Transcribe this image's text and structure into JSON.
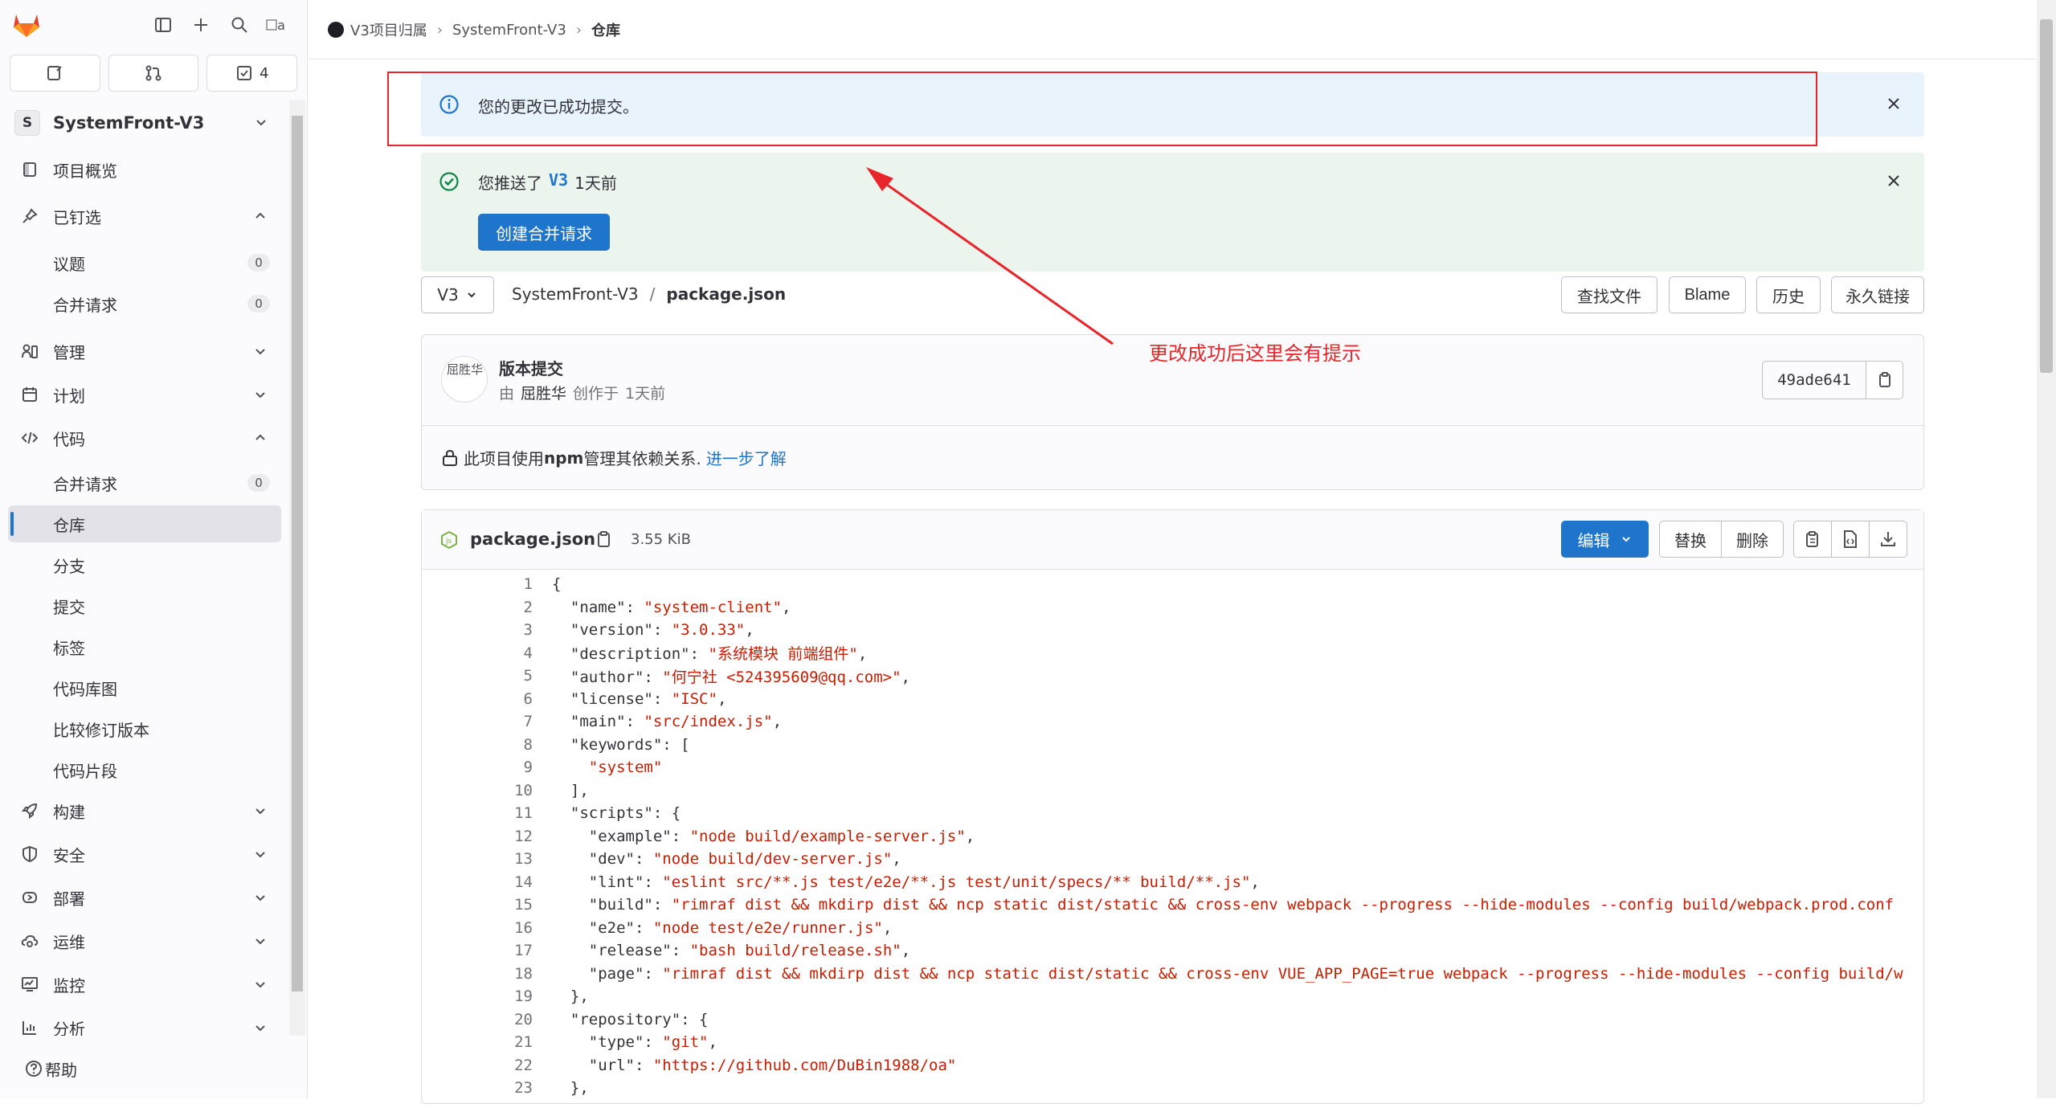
{
  "sidebar": {
    "user_avatar_alt": "a",
    "tabs": [
      {
        "icon": "issues-icon",
        "label": ""
      },
      {
        "icon": "merge-request-icon",
        "label": ""
      },
      {
        "icon": "todo-icon",
        "label": "4"
      }
    ],
    "project": {
      "avatar_letter": "S",
      "name": "SystemFront-V3"
    },
    "nav": {
      "overview": "项目概览",
      "pinned": "已钉选",
      "pinned_items": [
        {
          "label": "议题",
          "count": "0"
        },
        {
          "label": "合并请求",
          "count": "0"
        }
      ],
      "manage": "管理",
      "plan": "计划",
      "code": "代码",
      "code_items": [
        {
          "label": "合并请求",
          "count": "0"
        },
        {
          "label": "仓库"
        },
        {
          "label": "分支"
        },
        {
          "label": "提交"
        },
        {
          "label": "标签"
        },
        {
          "label": "代码库图"
        },
        {
          "label": "比较修订版本"
        },
        {
          "label": "代码片段"
        }
      ],
      "build": "构建",
      "secure": "安全",
      "deploy": "部署",
      "operate": "运维",
      "monitor": "监控",
      "analyze": "分析",
      "help": "帮助"
    }
  },
  "breadcrumb": {
    "group": "V3项目归属",
    "project": "SystemFront-V3",
    "current": "仓库"
  },
  "alerts": {
    "info": "您的更改已成功提交。",
    "push_prefix": "您推送了",
    "push_branch": "V3",
    "push_suffix": "1天前",
    "create_mr": "创建合并请求"
  },
  "path": {
    "branch": "V3",
    "project": "SystemFront-V3",
    "sep": "/",
    "file": "package.json",
    "buttons": {
      "find": "查找文件",
      "blame": "Blame",
      "history": "历史",
      "permalink": "永久链接"
    }
  },
  "commit": {
    "avatar_alt": "屈胜华",
    "title": "版本提交",
    "by": "由",
    "author": "屈胜华",
    "authored": "创作于",
    "when": "1天前",
    "sha": "49ade641",
    "npm_prefix": "此项目使用",
    "npm_bold": "npm",
    "npm_suffix": "管理其依赖关系.",
    "learn_more": "进一步了解"
  },
  "file": {
    "name": "package.json",
    "size": "3.55 KiB",
    "edit": "编辑",
    "replace": "替换",
    "delete": "删除"
  },
  "code_lines": [
    "{",
    "  \"name\": \"system-client\",",
    "  \"version\": \"3.0.33\",",
    "  \"description\": \"系统模块 前端组件\",",
    "  \"author\": \"何宁社 <524395609@qq.com>\",",
    "  \"license\": \"ISC\",",
    "  \"main\": \"src/index.js\",",
    "  \"keywords\": [",
    "    \"system\"",
    "  ],",
    "  \"scripts\": {",
    "    \"example\": \"node build/example-server.js\",",
    "    \"dev\": \"node build/dev-server.js\",",
    "    \"lint\": \"eslint src/**.js test/e2e/**.js test/unit/specs/** build/**.js\",",
    "    \"build\": \"rimraf dist && mkdirp dist && ncp static dist/static && cross-env webpack --progress --hide-modules --config build/webpack.prod.conf",
    "    \"e2e\": \"node test/e2e/runner.js\",",
    "    \"release\": \"bash build/release.sh\",",
    "    \"page\": \"rimraf dist && mkdirp dist && ncp static dist/static && cross-env VUE_APP_PAGE=true webpack --progress --hide-modules --config build/w",
    "  },",
    "  \"repository\": {",
    "    \"type\": \"git\",",
    "    \"url\": \"https://github.com/DuBin1988/oa\"",
    "  },"
  ],
  "annotation": "更改成功后这里会有提示",
  "colors": {
    "brand": "#fc6d26",
    "primary": "#1f75cb",
    "annotation": "#e8252a",
    "success": "#108548"
  }
}
